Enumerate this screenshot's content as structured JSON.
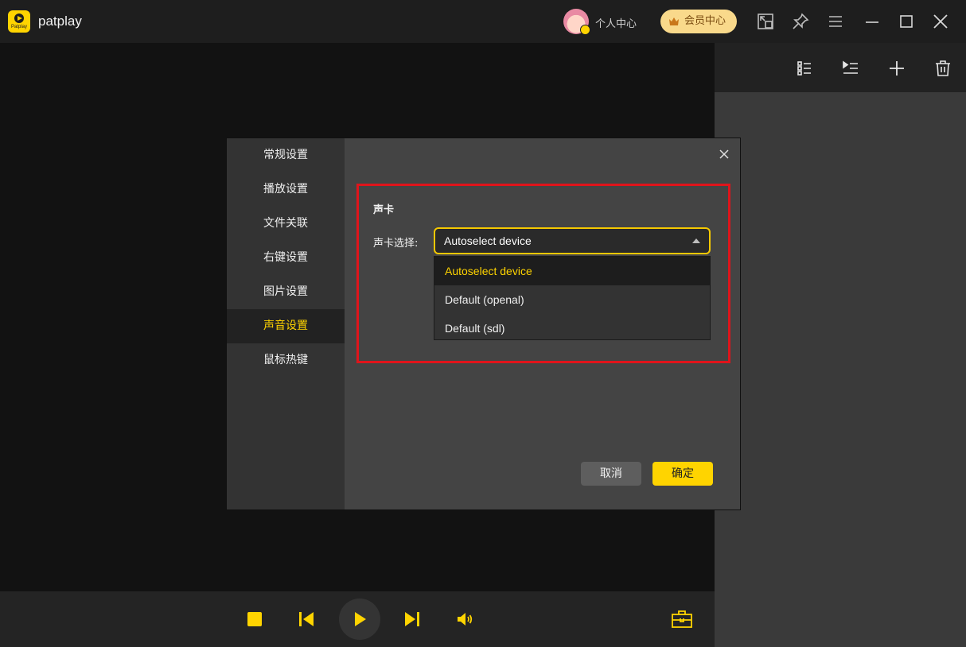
{
  "app": {
    "name": "patplay",
    "logo_text": "Patplay"
  },
  "titlebar": {
    "user_center": "个人中心",
    "vip_center": "会员中心"
  },
  "dialog": {
    "nav": [
      "常规设置",
      "播放设置",
      "文件关联",
      "右键设置",
      "图片设置",
      "声音设置",
      "鼠标热键"
    ],
    "active_index": 5,
    "section_title": "声卡",
    "field_label": "声卡选择:",
    "select_value": "Autoselect device",
    "options": [
      "Autoselect device",
      "Default (openal)",
      "Default (sdl)"
    ],
    "selected_option": 0,
    "cancel": "取消",
    "ok": "确定"
  },
  "colors": {
    "accent": "#ffd400",
    "highlight_border": "#e0141b",
    "vip_bg": "#f9d98b"
  }
}
